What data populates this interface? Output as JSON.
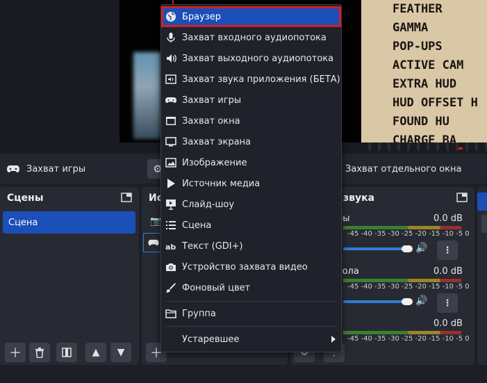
{
  "preview": {
    "paper_lines": [
      "FEATHER",
      "GAMMA",
      "POP-UPS",
      "ACTIVE CAM",
      "EXTRA HUD",
      "HUD OFFSET H",
      "FOUND HU",
      "CHARGE BA"
    ]
  },
  "source_bar": {
    "current_source": "Захват игры",
    "window_capture_label": "Захват отдельного окна"
  },
  "scenes": {
    "title": "Сцены",
    "items": [
      "Сцена"
    ]
  },
  "sources": {
    "title_partial": "Ис"
  },
  "mixer": {
    "title_partial": "звука",
    "channels": [
      {
        "name": "ры",
        "db": "0.0 dB"
      },
      {
        "name": "тола",
        "db": "0.0 dB"
      },
      {
        "name": "",
        "db": "0.0 dB"
      }
    ],
    "ticks": "-45 -40 -35 -30 -25 -20 -15 -10 -5 0"
  },
  "context_menu": {
    "items": [
      {
        "label": "Браузер",
        "icon": "globe-icon",
        "selected": true
      },
      {
        "label": "Захват входного аудиопотока",
        "icon": "microphone-icon"
      },
      {
        "label": "Захват выходного аудиопотока",
        "icon": "speaker-icon"
      },
      {
        "label": "Захват звука приложения (БЕТА)",
        "icon": "app-audio-icon"
      },
      {
        "label": "Захват игры",
        "icon": "gamepad-icon"
      },
      {
        "label": "Захват окна",
        "icon": "window-icon"
      },
      {
        "label": "Захват экрана",
        "icon": "monitor-icon"
      },
      {
        "label": "Изображение",
        "icon": "image-icon"
      },
      {
        "label": "Источник медиа",
        "icon": "play-icon"
      },
      {
        "label": "Слайд-шоу",
        "icon": "slideshow-icon"
      },
      {
        "label": "Сцена",
        "icon": "list-icon"
      },
      {
        "label": "Текст (GDI+)",
        "icon": "text-icon"
      },
      {
        "label": "Устройство захвата видео",
        "icon": "camera-icon"
      },
      {
        "label": "Фоновый цвет",
        "icon": "brush-icon"
      }
    ],
    "group_label": "Группа",
    "deprecated_label": "Устаревшее"
  },
  "colors": {
    "accent": "#1b4fb8",
    "highlight_border": "#d11f26"
  }
}
